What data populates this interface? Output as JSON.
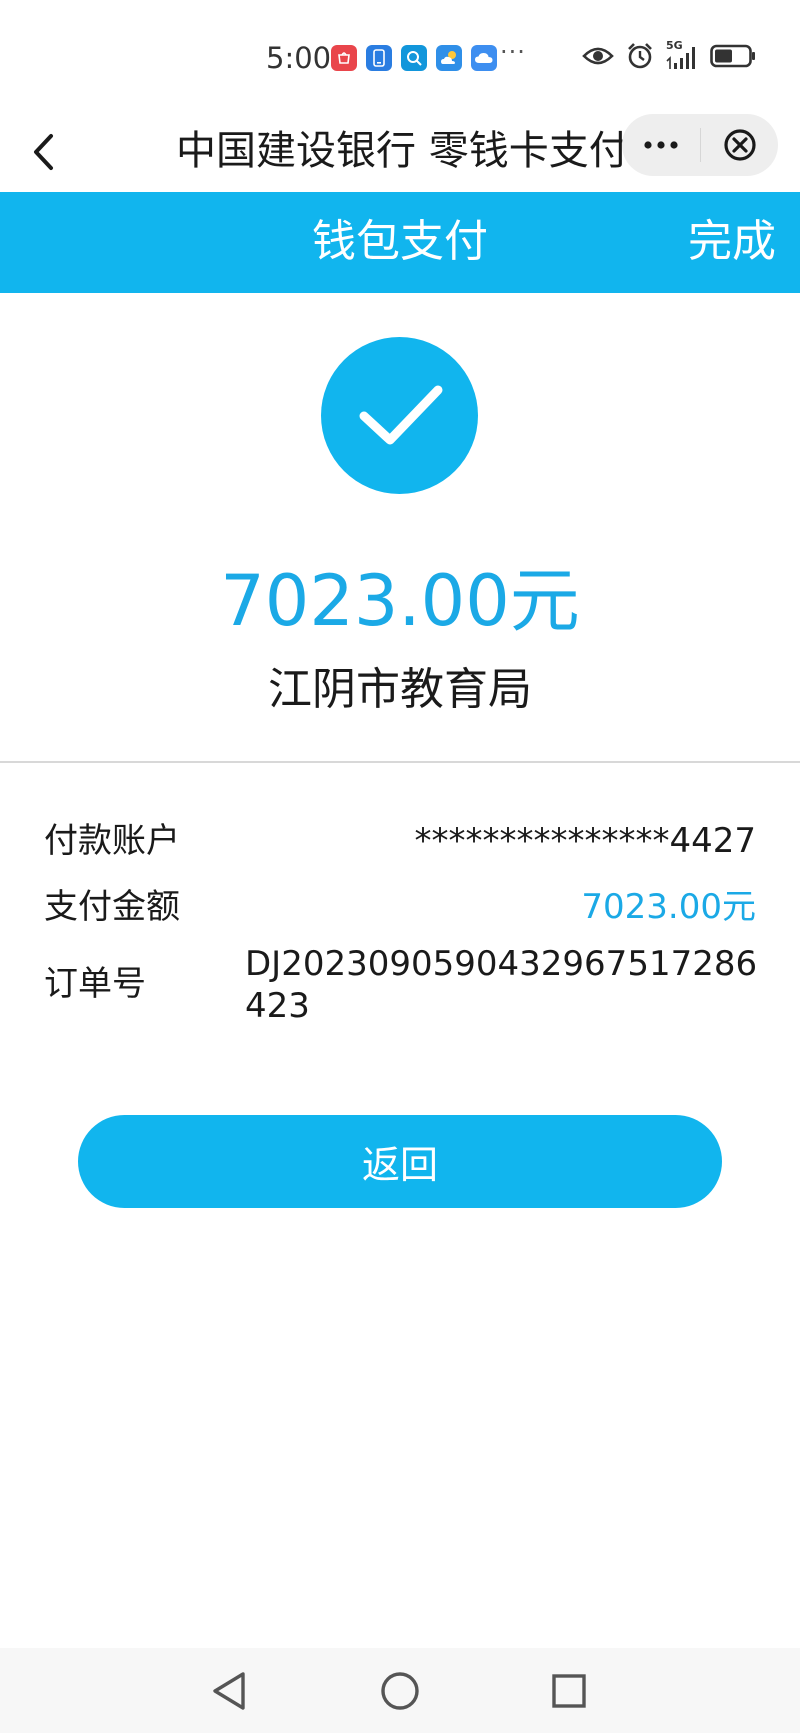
{
  "status_bar": {
    "time": "5:00",
    "network": "5G",
    "more_dots": "···",
    "notification_icons": [
      {
        "name": "shop-app-icon",
        "color": "#e9454b"
      },
      {
        "name": "phone-app-icon",
        "color": "#2a7de1"
      },
      {
        "name": "search-app-icon",
        "color": "#1296db"
      },
      {
        "name": "weather-app-icon",
        "color": "#2f8fe8"
      },
      {
        "name": "cloud-app-icon",
        "color": "#3d8ef0"
      }
    ]
  },
  "nav": {
    "title": "中国建设银行 零钱卡支付"
  },
  "header": {
    "title": "钱包支付",
    "done_label": "完成"
  },
  "result": {
    "amount": "7023.00元",
    "merchant": "江阴市教育局"
  },
  "details": {
    "account_label": "付款账户",
    "account_value": "***************4427",
    "amount_label": "支付金额",
    "amount_value": "7023.00元",
    "order_label": "订单号",
    "order_value": "DJ2023090590432967517286423"
  },
  "actions": {
    "return_label": "返回"
  },
  "colors": {
    "accent": "#11b5ee",
    "amount_text": "#1ba9e6"
  }
}
